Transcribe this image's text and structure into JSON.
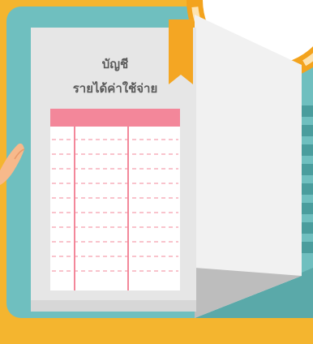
{
  "book": {
    "title_line1": "บัญชี",
    "title_line2": "รายได้ค่าใช้จ่าย"
  },
  "ledger": {
    "columns": 3,
    "rows": 10
  },
  "colors": {
    "frame_outer": "#f4b52f",
    "frame_inner": "#6fbfbf",
    "page": "#e6e6e6",
    "page_shadow": "#c7c7c7",
    "ribbon": "#f4a623",
    "ledger_header": "#f3879a",
    "ledger_line": "#f3879a",
    "sun": "#f3a31d"
  },
  "icons": [
    "book-illustration",
    "bookmark-ribbon",
    "sun-decoration",
    "hand-illustration"
  ]
}
